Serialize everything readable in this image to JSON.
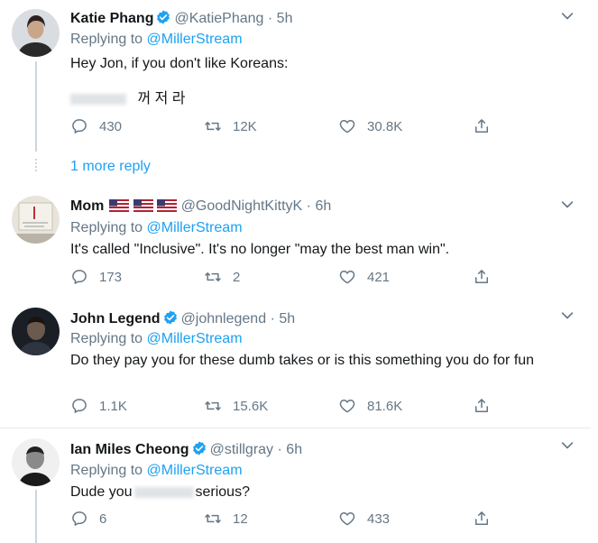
{
  "tweets": [
    {
      "name": "Katie Phang",
      "handle": "@KatiePhang",
      "time": "· 5h",
      "replying_label": "Replying to",
      "replying_to": "@MillerStream",
      "text1": "Hey Jon, if you don't like Koreans:",
      "text2": "꺼 저 라",
      "reply": "430",
      "retweet": "12K",
      "like": "30.8K",
      "more_replies": "1 more reply"
    },
    {
      "name": "Mom",
      "handle": "@GoodNightKittyK",
      "time": "· 6h",
      "replying_label": "Replying to",
      "replying_to": "@MillerStream",
      "text": "It's called \"Inclusive\". It's no longer \"may the best man win\".",
      "reply": "173",
      "retweet": "2",
      "like": "421"
    },
    {
      "name": "John Legend",
      "handle": "@johnlegend",
      "time": "· 5h",
      "replying_label": "Replying to",
      "replying_to": "@MillerStream",
      "text": "Do they pay you for these dumb takes or is this something you do for fun",
      "reply": "1.1K",
      "retweet": "15.6K",
      "like": "81.6K"
    },
    {
      "name": "Ian Miles Cheong",
      "handle": "@stillgray",
      "time": "· 6h",
      "replying_label": "Replying to",
      "replying_to": "@MillerStream",
      "text_before": "Dude you",
      "text_after": "serious?",
      "reply": "6",
      "retweet": "12",
      "like": "433"
    }
  ],
  "colors": {
    "accent": "#1da1f2",
    "secondary_text": "#657786",
    "divider": "#e6ecf0"
  },
  "icons": [
    "chevron-down-icon",
    "verified-badge-icon",
    "reply-icon",
    "retweet-icon",
    "like-icon",
    "share-icon",
    "us-flag-icon"
  ]
}
